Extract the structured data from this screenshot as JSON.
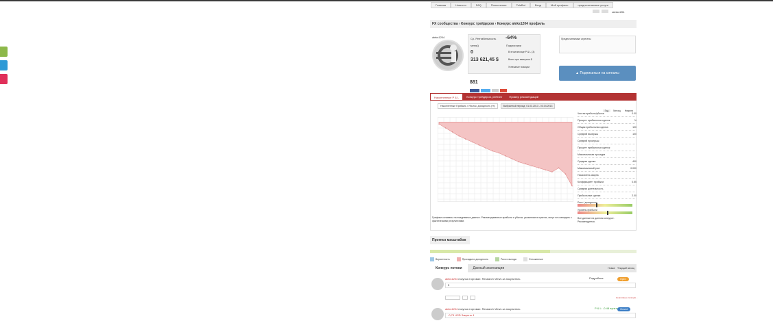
{
  "nav": {
    "items": [
      "Главная",
      "Новости",
      "FAQ",
      "Пополнение",
      "TeleBot",
      "Вход",
      "Мой профиль",
      "предпочитаемые услуги"
    ]
  },
  "user": {
    "name": "aleks1204"
  },
  "breadcrumb": [
    "FX сообщества",
    "Конкурс трейдеров",
    "Конкурс aleks1204 профиль"
  ],
  "profile": {
    "username": "aleks1204",
    "gain_label": "Ср. Рентабельность",
    "gain": "-64%",
    "balance_label": "меня()",
    "balance": "0",
    "equity": "313 621,45 $",
    "trades": "881",
    "subscribers_label": "Подписчики",
    "subscriptions_label": "Предпочитаемые агрегаты",
    "subscribe_button": "Подписаться на сигналы",
    "rank_label": "В этом месяце P & L (3)",
    "all_time_label": "Всего про выигрыш $",
    "success_label": "Успешные позиции"
  },
  "tabs": [
    "Накопленные P & L",
    "Конкурс трейдеров, рейтинг",
    "Пример рекомендаций"
  ],
  "chart_tabs": [
    "Накопленные Прибыль / Убыток, доходность (%)",
    "Выбранный период: 01.03.2013 - 03.04.2013"
  ],
  "chart_tools": [
    "Год",
    "Месяц",
    "Неделя"
  ],
  "chart_data": {
    "type": "area",
    "title": "",
    "xlabel": "",
    "ylabel": "",
    "x": [
      0,
      5,
      10,
      15,
      20,
      25,
      30,
      35,
      40,
      45,
      50,
      55,
      60,
      65,
      70,
      75,
      80,
      85,
      90,
      95,
      100
    ],
    "values": [
      -2,
      -6,
      -10,
      -14,
      -17,
      -20,
      -23,
      -26,
      -29,
      -31,
      -34,
      -37,
      -40,
      -42,
      -44,
      -46,
      -48,
      -50,
      -46,
      -52,
      -64
    ],
    "grid": true
  },
  "chart_note": "Графики основаны на ежедневных данных. Рекомендованные прибыли и убытки, указанные в пунктах, могут не совпадать с фактическими результатами.",
  "metrics": [
    {
      "label": "Чистая прибыль/убыток",
      "value": "0.00"
    },
    {
      "label": "Процент прибыльных сделок",
      "value": "%"
    },
    {
      "label": "Общая прибыльная сделка",
      "value": "100"
    },
    {
      "label": "Средний выигрыш",
      "value": "100"
    },
    {
      "label": "Средний проигрыш",
      "value": ""
    },
    {
      "label": "Процент прибыльных сделок",
      "value": ""
    },
    {
      "label": "Максимальная просадка",
      "value": ""
    },
    {
      "label": "Средняя сделка",
      "value": "400"
    },
    {
      "label": "Максимальный рост",
      "value": "0.000"
    },
    {
      "label": "Показатель Шарпа",
      "value": ""
    },
    {
      "label": "Коэффициент прибыли",
      "value": "0.55"
    },
    {
      "label": "Средняя длительность",
      "value": ""
    },
    {
      "label": "Прибыльные сделки",
      "value": "2.00"
    }
  ],
  "gauges": [
    {
      "label": "Риск / доходность",
      "value": 0.35
    },
    {
      "label": "Уровень прибыли",
      "value": 0.55
    }
  ],
  "metrics_note": "Все данные на данном конкурсе. Рекомендуется.",
  "forecast": {
    "title": "Прогноз масштабов",
    "progress": 0.58
  },
  "legend": [
    {
      "label": "Вероятность",
      "color": "#9ec8e6"
    },
    {
      "label": "Просадка и доходность",
      "color": "#f0b0b0"
    },
    {
      "label": "Риск и выгода",
      "color": "#b6d6a0"
    },
    {
      "label": "Отложенные",
      "color": "#e0e0e0"
    }
  ],
  "contest_tabs": [
    "Конкурс потоки",
    "Данный экспозиции"
  ],
  "contest_filter": [
    "Новые",
    "Текущий месяц"
  ],
  "posts": [
    {
      "user": "aleks1204",
      "text": "покупка торговал: Research Views за покупатель",
      "status": "Подробнее",
      "body": "5",
      "footer": "Неактивные позиции...",
      "badge": "Open",
      "badge_color": "#f0a030"
    },
    {
      "user": "aleks1204",
      "text": "покупка торговал: Research Views за покупатель",
      "status": "P & L: -0.48 пунктов",
      "body": "-0,75 USD Закрыть 4",
      "badge": "Closed",
      "badge_color": "#3d7fc6"
    }
  ]
}
